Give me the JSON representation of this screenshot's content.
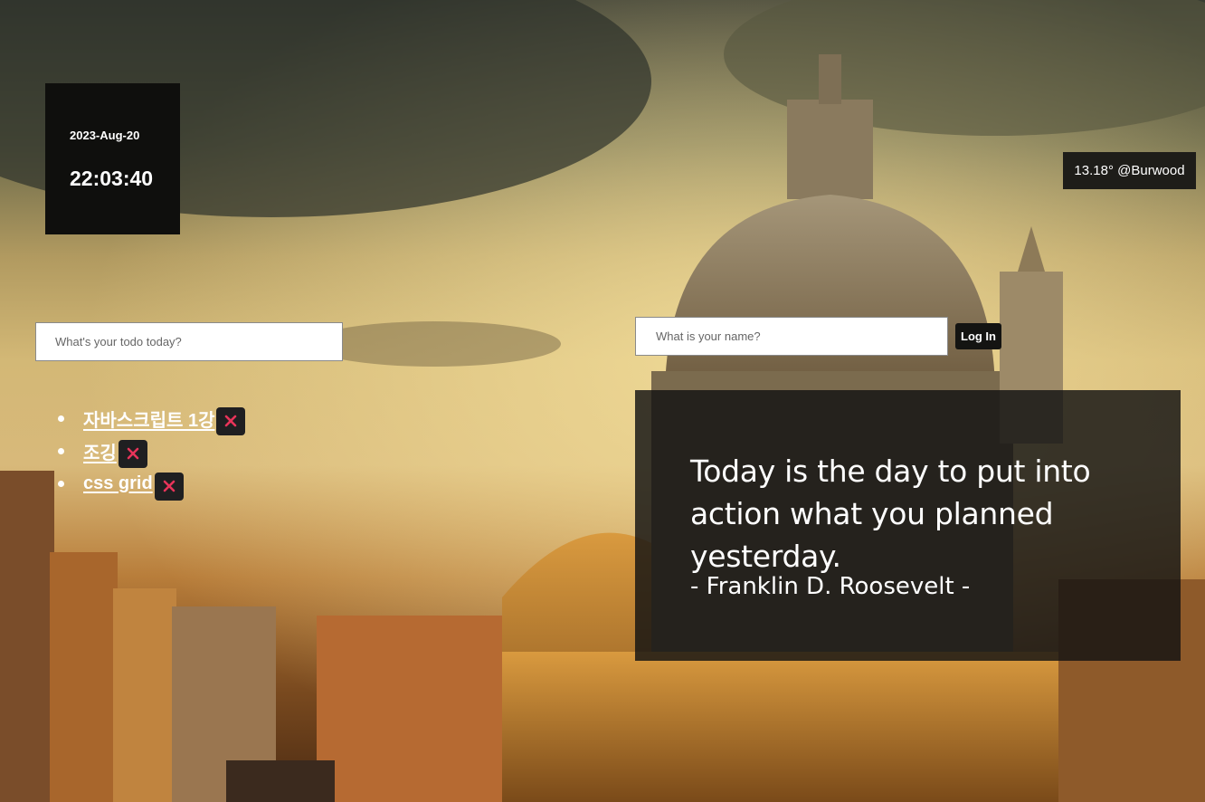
{
  "clock": {
    "date": "2023-Aug-20",
    "time": "22:03:40"
  },
  "weather": {
    "text": "13.18° @Burwood"
  },
  "todo": {
    "placeholder": "What's your todo today?",
    "items": [
      {
        "text": "자바스크립트 1강"
      },
      {
        "text": "조깅"
      },
      {
        "text": "css grid"
      }
    ],
    "delete_icon": "close-icon",
    "delete_color": "#e8345a"
  },
  "login": {
    "placeholder": "What is your name?",
    "button_label": "Log In"
  },
  "quote": {
    "text": "Today is the day to put into action what you planned yesterday.",
    "author": "- Franklin D. Roosevelt -"
  }
}
